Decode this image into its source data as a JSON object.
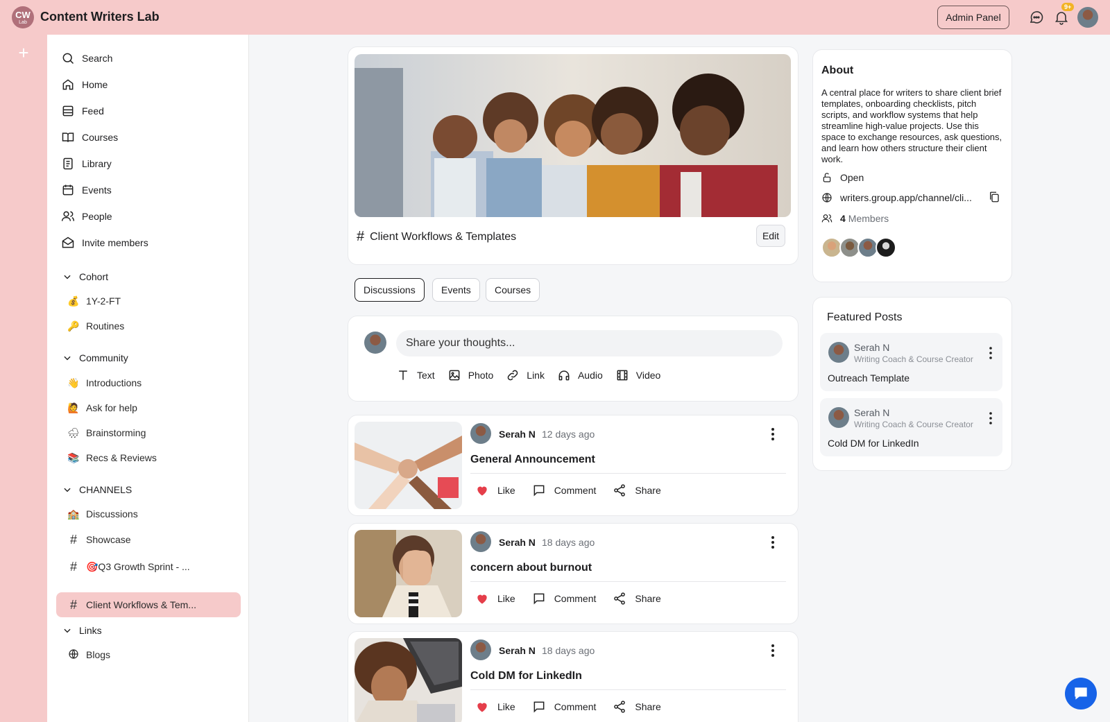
{
  "app": {
    "logo_text": "CW",
    "logo_sub": "Lab",
    "title": "Content Writers Lab",
    "admin_label": "Admin Panel",
    "notif_badge": "9+"
  },
  "nav": [
    {
      "label": "Search",
      "icon": "search-icon"
    },
    {
      "label": "Home",
      "icon": "home-icon"
    },
    {
      "label": "Feed",
      "icon": "feed-icon"
    },
    {
      "label": "Courses",
      "icon": "book-icon"
    },
    {
      "label": "Library",
      "icon": "library-icon"
    },
    {
      "label": "Events",
      "icon": "calendar-icon"
    },
    {
      "label": "People",
      "icon": "people-icon"
    },
    {
      "label": "Invite members",
      "icon": "mail-icon"
    }
  ],
  "sections": {
    "cohort": {
      "title": "Cohort",
      "items": [
        {
          "emoji": "💰",
          "label": "1Y-2-FT"
        },
        {
          "emoji": "🔑",
          "label": "Routines"
        }
      ]
    },
    "community": {
      "title": "Community",
      "items": [
        {
          "emoji": "👋",
          "label": "Introductions"
        },
        {
          "emoji": "🙋",
          "label": "Ask for help"
        },
        {
          "emoji": "🌧",
          "label": "Brainstorming"
        },
        {
          "emoji": "📚",
          "label": "Recs & Reviews"
        }
      ]
    },
    "channels": {
      "title": "CHANNELS",
      "items": [
        {
          "emoji": "🏫",
          "label": "Discussions"
        },
        {
          "hash": "#",
          "label": "Showcase"
        },
        {
          "hash": "#",
          "label": "🎯Q3 Growth Sprint - ..."
        },
        {
          "hash": "#",
          "label": "Client Workflows & Tem..."
        }
      ]
    },
    "links": {
      "title": "Links",
      "items": [
        {
          "label": "Blogs"
        }
      ]
    }
  },
  "channel": {
    "hash": "#",
    "title": "Client Workflows & Templates",
    "edit_label": "Edit"
  },
  "tabs": [
    "Discussions",
    "Events",
    "Courses"
  ],
  "composer": {
    "placeholder": "Share your thoughts...",
    "tools": [
      "Text",
      "Photo",
      "Link",
      "Audio",
      "Video"
    ]
  },
  "posts": [
    {
      "author": "Serah N",
      "time": "12 days ago",
      "title": "General Announcement",
      "like": "Like",
      "comment": "Comment",
      "share": "Share"
    },
    {
      "author": "Serah N",
      "time": "18 days ago",
      "title": "concern about burnout",
      "like": "Like",
      "comment": "Comment",
      "share": "Share"
    },
    {
      "author": "Serah N",
      "time": "18 days ago",
      "title": "Cold DM for LinkedIn",
      "like": "Like",
      "comment": "Comment",
      "share": "Share"
    }
  ],
  "about": {
    "title": "About",
    "description": "A central place for writers to share client brief templates, onboarding checklists, pitch scripts, and workflow systems that help streamline high-value projects. Use this space to exchange resources, ask questions, and learn how others structure their client work.",
    "privacy": "Open",
    "url": "writers.group.app/channel/cli...",
    "members_count": "4",
    "members_label": "Members"
  },
  "featured": {
    "title": "Featured Posts",
    "items": [
      {
        "name": "Serah N",
        "role": "Writing Coach & Course Creator",
        "post": "Outreach Template"
      },
      {
        "name": "Serah N",
        "role": "Writing Coach & Course Creator",
        "post": "Cold DM for LinkedIn"
      }
    ]
  },
  "colors": {
    "accent": "#f6caca",
    "like": "#e53e4a",
    "fab": "#1763e8"
  }
}
